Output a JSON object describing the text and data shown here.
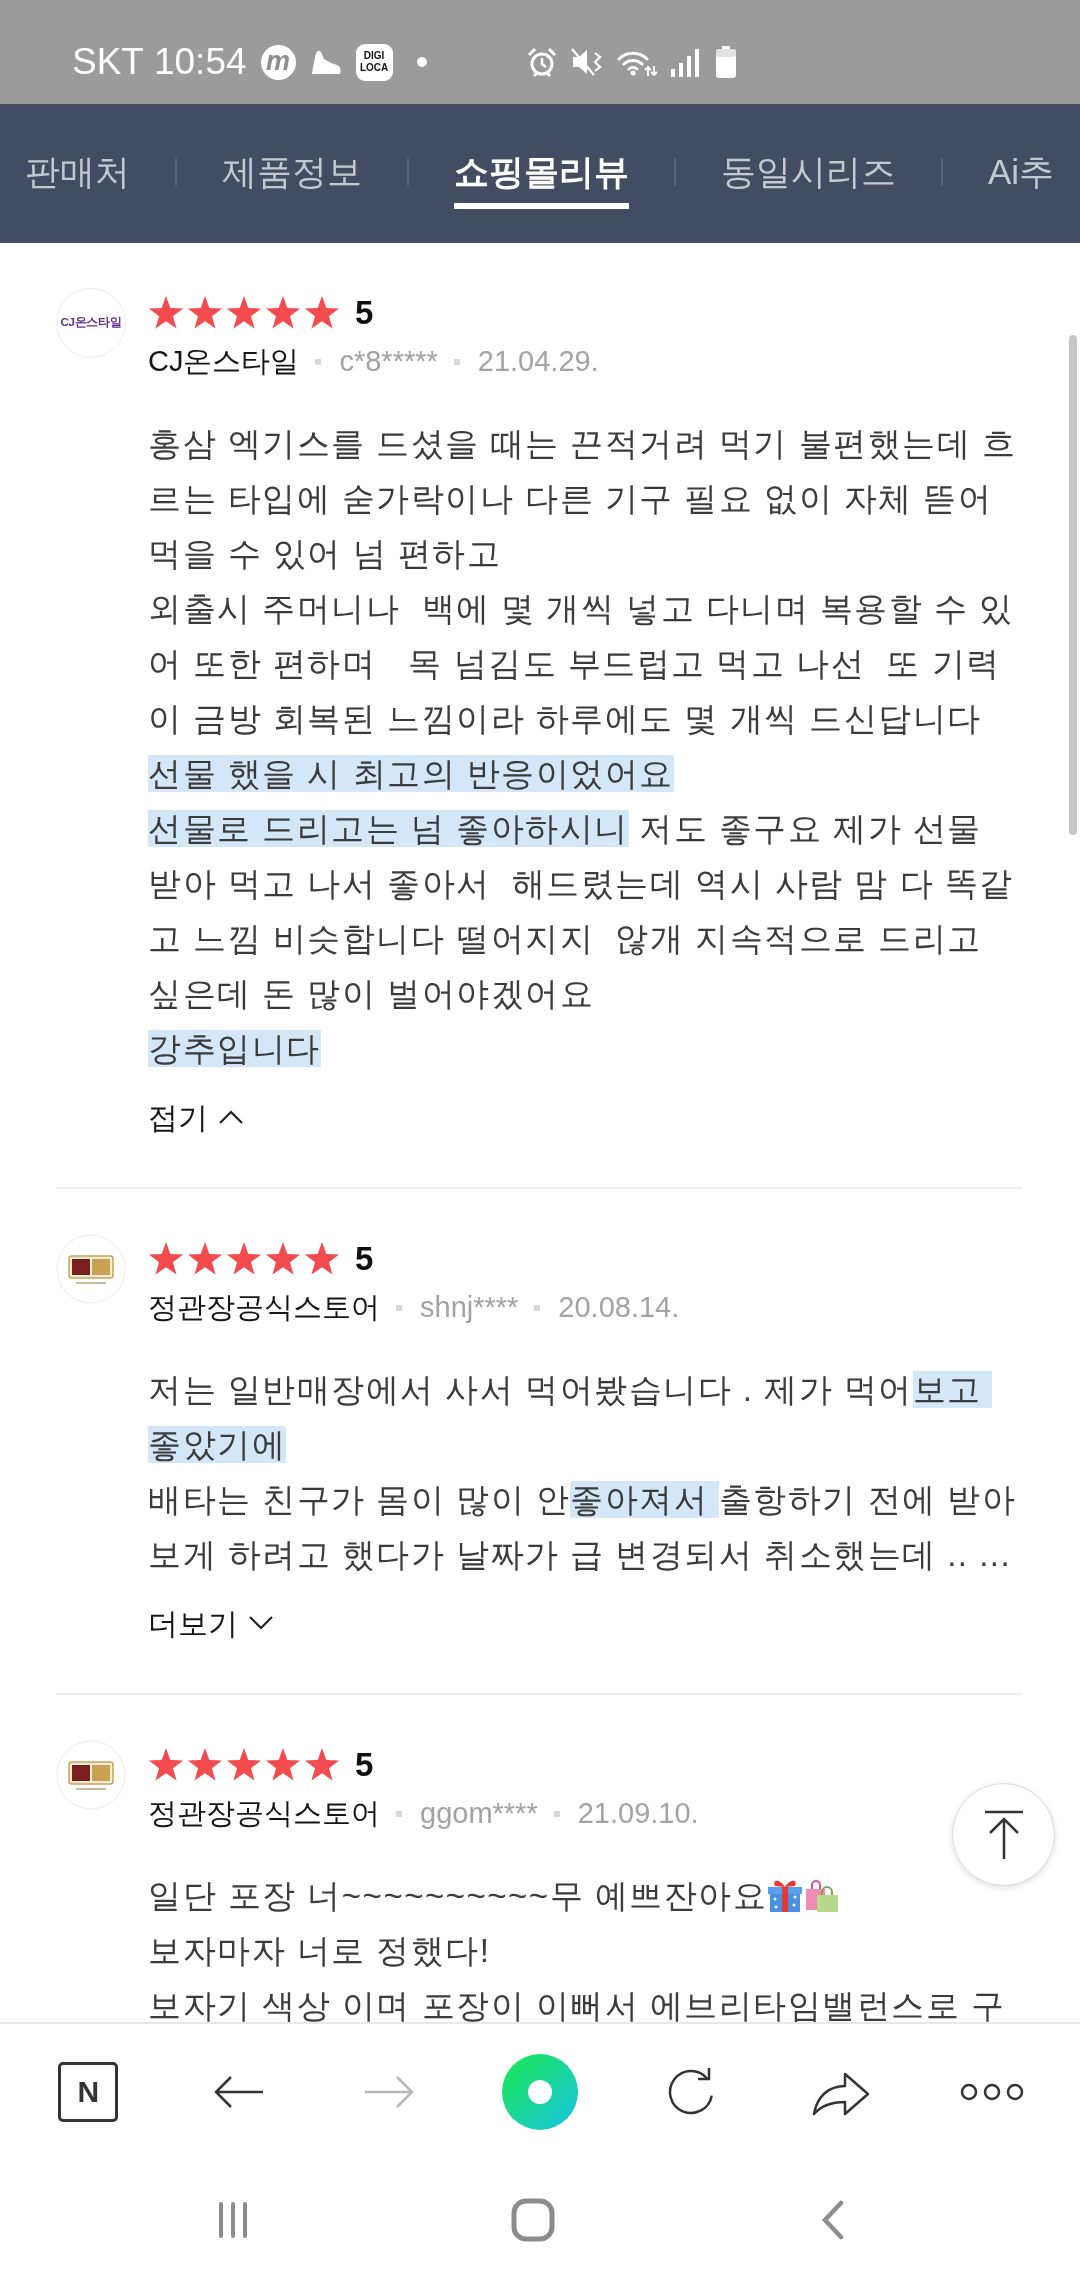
{
  "status_bar": {
    "carrier": "SKT",
    "time": "10:54",
    "app_letter": "m",
    "app_badge": [
      "DIGI",
      "LOCA"
    ]
  },
  "tabs": [
    {
      "label": "판매처",
      "selected": false
    },
    {
      "label": "제품정보",
      "selected": false
    },
    {
      "label": "쇼핑몰리뷰",
      "selected": true
    },
    {
      "label": "동일시리즈",
      "selected": false
    },
    {
      "label": "Ai추",
      "selected": false
    }
  ],
  "reviews": [
    {
      "logo": {
        "kind": "wordmark",
        "text": "CJ온스타일"
      },
      "stars": 5,
      "rating": "5",
      "seller": "CJ온스타일",
      "user": "c*8*****",
      "date": "21.04.29.",
      "lines": [
        {
          "parts": [
            {
              "kind": "text",
              "text": "홍삼 엑기스를 드셨을 때는 끈적거려 먹기 불편했는데 흐",
              "highlighted": false
            }
          ]
        },
        {
          "parts": [
            {
              "kind": "text",
              "text": "르는 타입에 숟가락이나 다른 기구 필요 없이 자체 뜯어",
              "highlighted": false
            }
          ]
        },
        {
          "parts": [
            {
              "kind": "text",
              "text": "먹을 수 있어 넘 편하고",
              "highlighted": false
            }
          ]
        },
        {
          "parts": [
            {
              "kind": "text",
              "text": "외출시 주머니나  백에 몇 개씩 넣고 다니며 복용할 수 있",
              "highlighted": false
            }
          ]
        },
        {
          "parts": [
            {
              "kind": "text",
              "text": "어 또한 편하며   목 넘김도 부드럽고 먹고 나선  또 기력",
              "highlighted": false
            }
          ]
        },
        {
          "parts": [
            {
              "kind": "text",
              "text": "이 금방 회복된 느낌이라 하루에도 몇 개씩 드신답니다",
              "highlighted": false
            }
          ]
        },
        {
          "parts": [
            {
              "kind": "text",
              "text": "선물 했을 시 최고의 반응이었어요",
              "highlighted": true
            }
          ]
        },
        {
          "parts": [
            {
              "kind": "text",
              "text": "선물로 드리고는 넘 좋아하시니",
              "highlighted": true
            },
            {
              "kind": "text",
              "text": " 저도 좋구요 제가 선물",
              "highlighted": false
            }
          ]
        },
        {
          "parts": [
            {
              "kind": "text",
              "text": "받아 먹고 나서 좋아서  해드렸는데 역시 사람 맘 다 똑같",
              "highlighted": false
            }
          ]
        },
        {
          "parts": [
            {
              "kind": "text",
              "text": "고 느낌 비슷합니다 떨어지지  않개 지속적으로 드리고",
              "highlighted": false
            }
          ]
        },
        {
          "parts": [
            {
              "kind": "text",
              "text": "싶은데 돈 많이 벌어야겠어요",
              "highlighted": false
            }
          ]
        },
        {
          "parts": [
            {
              "kind": "text",
              "text": "강추입니다",
              "highlighted": true
            }
          ]
        }
      ],
      "toggle": {
        "label": "접기",
        "expanded": true
      }
    },
    {
      "logo": {
        "kind": "emblem"
      },
      "stars": 5,
      "rating": "5",
      "seller": "정관장공식스토어",
      "user": "shnj****",
      "date": "20.08.14.",
      "lines": [
        {
          "parts": [
            {
              "kind": "text",
              "text": "저는 일반매장에서 사서 먹어봤습니다 . 제가 먹어",
              "highlighted": false
            },
            {
              "kind": "text",
              "text": "보고 ",
              "highlighted": true
            }
          ]
        },
        {
          "parts": [
            {
              "kind": "text",
              "text": "좋았기에",
              "highlighted": true
            }
          ]
        },
        {
          "parts": [
            {
              "kind": "text",
              "text": "배타는 친구가 몸이 많이 안",
              "highlighted": false
            },
            {
              "kind": "text",
              "text": "좋아져서 ",
              "highlighted": true
            },
            {
              "kind": "text",
              "text": "출항하기 전에 받아",
              "highlighted": false
            }
          ]
        },
        {
          "parts": [
            {
              "kind": "text",
              "text": "보게 하려고 했다가 날짜가 급 변경되서 취소했는데 .. ...",
              "highlighted": false
            }
          ]
        }
      ],
      "toggle": {
        "label": "더보기",
        "expanded": false
      }
    },
    {
      "logo": {
        "kind": "emblem"
      },
      "stars": 5,
      "rating": "5",
      "seller": "정관장공식스토어",
      "user": "ggom****",
      "date": "21.09.10.",
      "lines": [
        {
          "parts": [
            {
              "kind": "text",
              "text": "일단 포장 너~~~~~~~~~~무 예쁘잔아요",
              "highlighted": false
            },
            {
              "kind": "gift"
            },
            {
              "kind": "bags"
            }
          ]
        },
        {
          "parts": [
            {
              "kind": "text",
              "text": "보자마자 너로 정했다!",
              "highlighted": false
            }
          ]
        },
        {
          "parts": [
            {
              "kind": "text",
              "text": "보자기 색상 이며 포장이 이뻐서 에브리타임밸런스로 구",
              "highlighted": false
            }
          ]
        }
      ]
    }
  ],
  "toolbar": [
    {
      "kind": "home",
      "label": "N",
      "disabled": false
    },
    {
      "kind": "back",
      "disabled": false
    },
    {
      "kind": "forward",
      "disabled": true
    },
    {
      "kind": "ring",
      "disabled": false
    },
    {
      "kind": "reload",
      "disabled": false
    },
    {
      "kind": "share",
      "disabled": false
    },
    {
      "kind": "more",
      "disabled": false
    }
  ]
}
